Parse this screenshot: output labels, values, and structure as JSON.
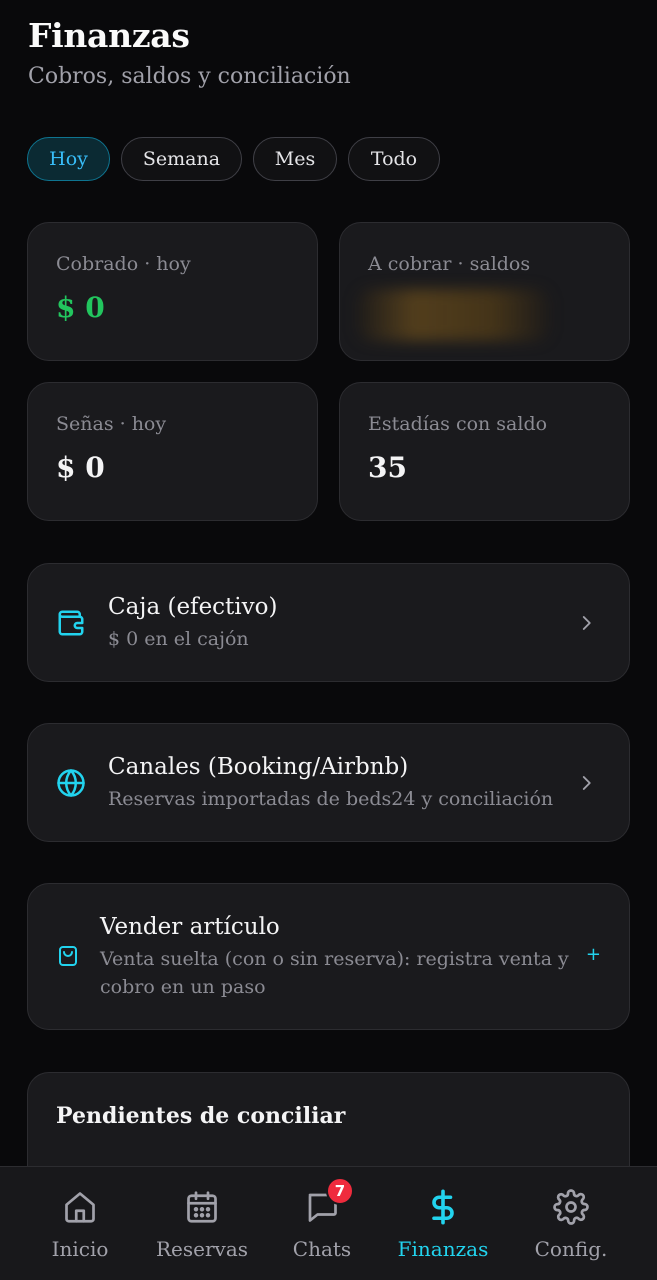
{
  "header": {
    "title": "Finanzas",
    "subtitle": "Cobros, saldos y conciliación"
  },
  "filters": [
    {
      "label": "Hoy",
      "active": true
    },
    {
      "label": "Semana",
      "active": false
    },
    {
      "label": "Mes",
      "active": false
    },
    {
      "label": "Todo",
      "active": false
    }
  ],
  "stats": {
    "cobrado": {
      "label": "Cobrado · hoy",
      "value": "$ 0"
    },
    "a_cobrar": {
      "label": "A cobrar · saldos",
      "value": ""
    },
    "senas": {
      "label": "Señas · hoy",
      "value": "$ 0"
    },
    "estadias": {
      "label": "Estadías con saldo",
      "value": "35"
    }
  },
  "rows": {
    "caja": {
      "title": "Caja (efectivo)",
      "subtitle": "$ 0 en el cajón",
      "icon": "wallet-icon"
    },
    "canales": {
      "title": "Canales (Booking/Airbnb)",
      "subtitle": "Reservas importadas de beds24 y conciliación",
      "icon": "globe-icon"
    },
    "vender": {
      "title": "Vender artículo",
      "subtitle_line1": "Venta suelta (con o sin reserva): registra venta y",
      "subtitle_line2": "cobro en un paso",
      "icon": "shopping-bag-icon",
      "action": "+"
    }
  },
  "pendientes": {
    "title": "Pendientes de conciliar"
  },
  "nav": {
    "items": [
      {
        "label": "Inicio",
        "icon": "home-icon"
      },
      {
        "label": "Reservas",
        "icon": "calendar-icon"
      },
      {
        "label": "Chats",
        "icon": "chat-icon",
        "badge": "7"
      },
      {
        "label": "Finanzas",
        "icon": "dollar-icon",
        "active": true
      },
      {
        "label": "Config.",
        "icon": "gear-icon"
      }
    ]
  },
  "colors": {
    "accent": "#22d3ee",
    "positive": "#22c55e",
    "badge": "#ef2b3d",
    "background": "#09090b",
    "card": "#1a1a1d"
  }
}
